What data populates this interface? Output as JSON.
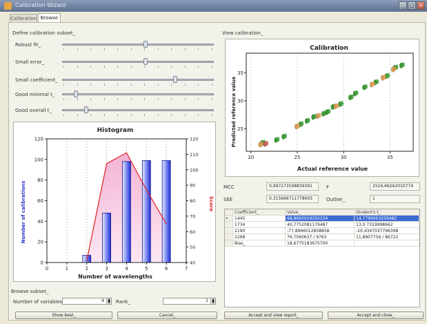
{
  "window": {
    "title": "Calibration Wizard",
    "minimize": "_",
    "maximize": "□",
    "close": "×"
  },
  "tabs": [
    "Calibration",
    "Browse"
  ],
  "left": {
    "define_label": "Define calibration subset_",
    "sliders": [
      {
        "label": "Robust fit_",
        "value": 0.55
      },
      {
        "label": "Small error_",
        "value": 0.55
      },
      {
        "label": "Small coefficient_",
        "value": 0.75
      },
      {
        "label": "Good minimal t_",
        "value": 0.08
      },
      {
        "label": "Good overall t_",
        "value": 0.15
      }
    ]
  },
  "chart_data": [
    {
      "type": "bar",
      "title": "Histogram",
      "xlabel": "Number of wavelengths",
      "ylabel": "Number of calibrations",
      "y2label": "Score",
      "x_ticks": [
        "0",
        "1",
        "2",
        "3",
        "4",
        "5",
        "6",
        "7"
      ],
      "y_ticks": [
        "0",
        "20",
        "40",
        "60",
        "80",
        "100",
        "120"
      ],
      "y2_ticks": [
        "40",
        "50",
        "60",
        "70",
        "80",
        "90",
        "100",
        "110",
        "120"
      ],
      "xlim": [
        0,
        7
      ],
      "ylim": [
        0,
        120
      ],
      "y2lim": [
        40,
        120
      ],
      "categories": [
        2,
        3,
        4,
        5,
        6
      ],
      "values": [
        7,
        48,
        98,
        99,
        99
      ],
      "score_line": {
        "x": [
          2,
          3,
          4,
          5,
          6
        ],
        "y": [
          41,
          104,
          111,
          87,
          65
        ]
      }
    },
    {
      "type": "scatter",
      "title": "Calibration",
      "xlabel": "Actual reference value",
      "ylabel": "Predicted reference value",
      "x_ticks": [
        "20",
        "25",
        "30",
        "35"
      ],
      "y_ticks": [
        "25",
        "30",
        "35"
      ],
      "xlim": [
        19.5,
        37.5
      ],
      "ylim": [
        21,
        38.5
      ],
      "series": [
        {
          "color": "#3a9a32",
          "points": [
            [
              21.2,
              22.5
            ],
            [
              22.7,
              23.0
            ],
            [
              23.5,
              23.6
            ],
            [
              25.3,
              25.8
            ],
            [
              26.0,
              26.4
            ],
            [
              26.7,
              27.1
            ],
            [
              27.8,
              27.7
            ],
            [
              28.2,
              28.0
            ],
            [
              28.8,
              28.9
            ],
            [
              29.6,
              29.4
            ],
            [
              30.7,
              30.6
            ],
            [
              31.2,
              31.3
            ],
            [
              32.2,
              32.4
            ],
            [
              33.4,
              33.3
            ],
            [
              34.6,
              34.4
            ],
            [
              35.5,
              35.9
            ],
            [
              36.2,
              36.3
            ]
          ]
        },
        {
          "color": "#e09a55",
          "points": [
            [
              21.0,
              22.2
            ],
            [
              24.9,
              25.4
            ],
            [
              27.2,
              27.3
            ],
            [
              29.1,
              29.0
            ],
            [
              33.0,
              32.9
            ],
            [
              34.2,
              34.1
            ],
            [
              35.3,
              35.6
            ]
          ]
        },
        {
          "color": "#c55a5a",
          "points": [
            [
              21.5,
              22.3
            ]
          ]
        }
      ]
    }
  ],
  "right": {
    "view_label": "View calibration_",
    "stats": [
      {
        "label": "MCC",
        "value": "0,997273508839391"
      },
      {
        "label": "F",
        "value": "2516,66262010774"
      },
      {
        "label": "SEE",
        "value": "0,315666711778003"
      },
      {
        "label": "Outlier_",
        "value": "1"
      }
    ],
    "table": {
      "headers": [
        "Coefficient_",
        "Value_",
        "Student's t_"
      ],
      "rows": [
        [
          "1445",
          "68,8693019350334",
          "14,7799003259482"
        ],
        [
          "1734",
          "40,7752081179487",
          "13,0 7319998662"
        ],
        [
          "2190",
          "-77,8966012858858",
          "-20,4347037796398"
        ],
        [
          "2298",
          "76,7560637 / 9763",
          "11,8907756 / 86722"
        ],
        [
          "Bias_",
          "18,6775183675700",
          ""
        ]
      ]
    }
  },
  "browse": {
    "label": "Browse subset_",
    "num_vars_label": "Number of variables_",
    "num_vars_value": "4",
    "rank_label": "Rank_",
    "rank_value": "1"
  },
  "buttons": {
    "show_best": "Show best_",
    "cancel": "Cancel_",
    "accept_new_report": "Accept and view report_",
    "accept_close": "Accept and close_"
  }
}
